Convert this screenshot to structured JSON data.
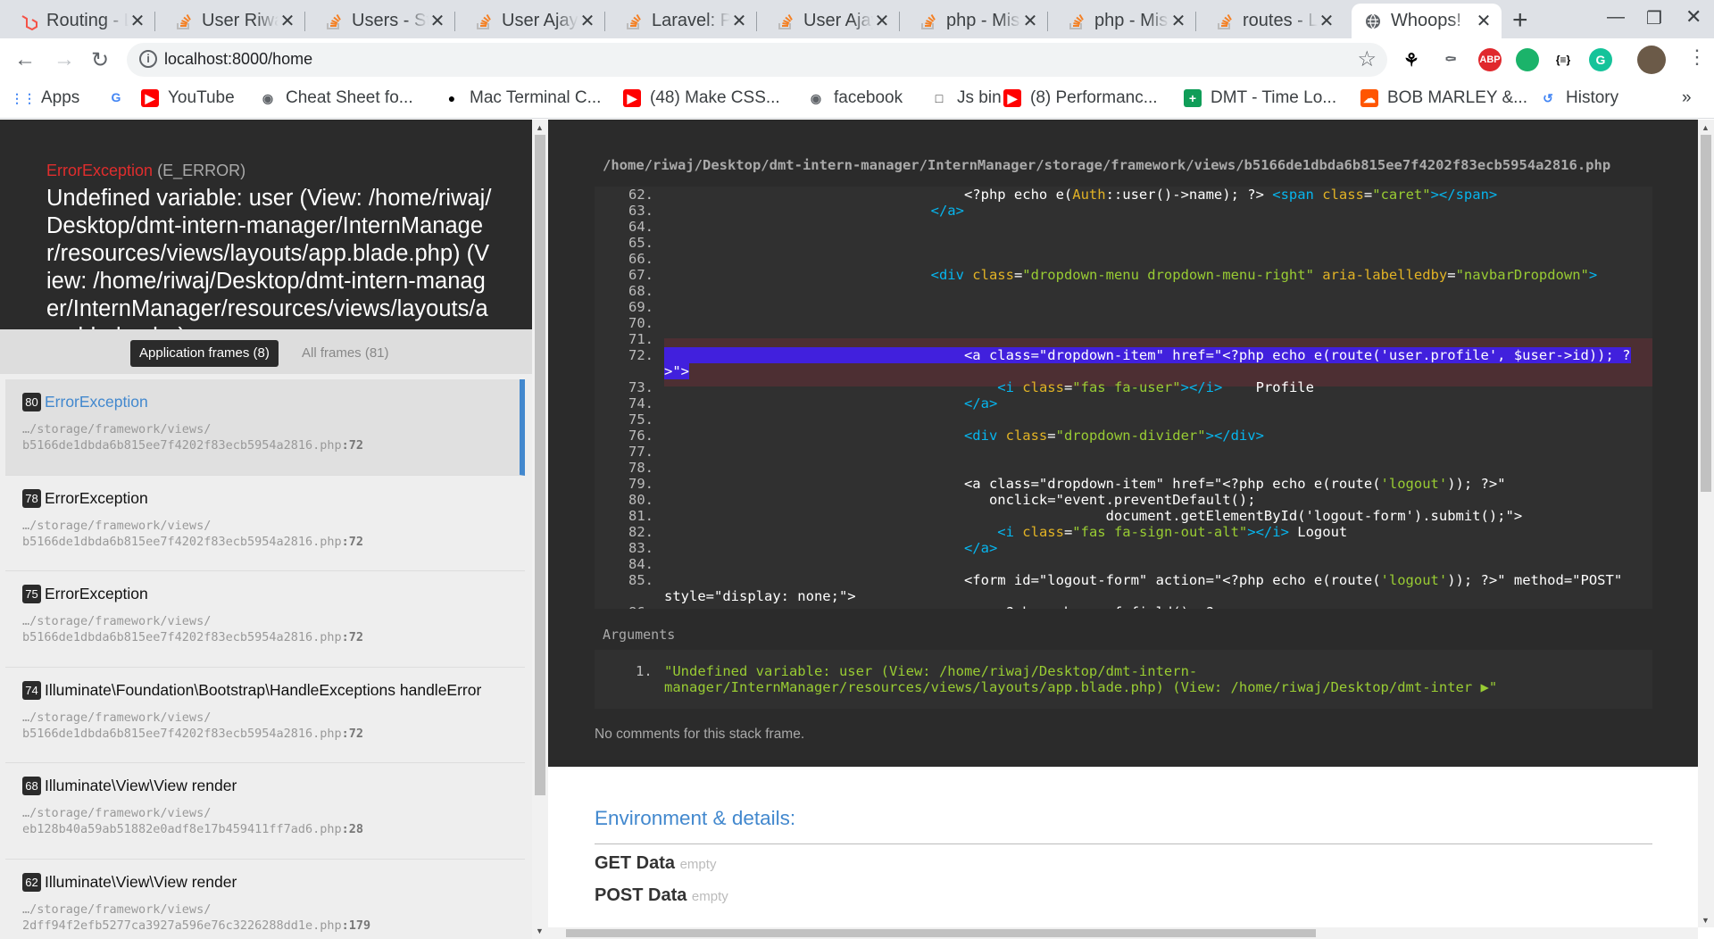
{
  "browser": {
    "tabs": [
      {
        "title": "Routing - Laravel",
        "favicon": "laravel-icon",
        "color": "#f55247"
      },
      {
        "title": "User Riwaj",
        "favicon": "stackoverflow-icon",
        "color": "#f48024"
      },
      {
        "title": "Users - Stack Overflow",
        "favicon": "stackoverflow-icon",
        "color": "#f48024"
      },
      {
        "title": "User Ajay",
        "favicon": "stackoverflow-icon",
        "color": "#f48024"
      },
      {
        "title": "Laravel: Pass",
        "favicon": "stackoverflow-icon",
        "color": "#f48024"
      },
      {
        "title": "User Ajay",
        "favicon": "stackoverflow-icon",
        "color": "#f48024"
      },
      {
        "title": "php - Mis",
        "favicon": "stackoverflow-icon",
        "color": "#f48024"
      },
      {
        "title": "php - Mis",
        "favicon": "stackoverflow-icon",
        "color": "#f48024"
      },
      {
        "title": "routes - L",
        "favicon": "stackoverflow-icon",
        "color": "#f48024"
      },
      {
        "title": "Whoops!",
        "favicon": "globe-icon",
        "color": "#5f6368",
        "active": true
      }
    ],
    "url": "localhost:8000/home",
    "bookmarks": [
      {
        "label": "Apps",
        "icon": "apps-grid-icon"
      },
      {
        "label": "",
        "icon": "google-icon"
      },
      {
        "label": "YouTube",
        "icon": "youtube-icon"
      },
      {
        "label": "Cheat Sheet fo...",
        "icon": "globe-icon"
      },
      {
        "label": "Mac Terminal C...",
        "icon": "github-icon"
      },
      {
        "label": "(48) Make CSS...",
        "icon": "youtube-icon"
      },
      {
        "label": "facebook",
        "icon": "globe-icon"
      },
      {
        "label": "Js bin",
        "icon": "jsbin-icon"
      },
      {
        "label": "(8) Performanc...",
        "icon": "youtube-icon"
      },
      {
        "label": "DMT - Time Lo...",
        "icon": "sheets-icon"
      },
      {
        "label": "BOB MARLEY &...",
        "icon": "soundcloud-icon"
      },
      {
        "label": "History",
        "icon": "history-icon"
      }
    ],
    "more_label": "»"
  },
  "exception": {
    "class": "ErrorException",
    "code": "(E_ERROR)",
    "message": "Undefined variable: user (View: /home/riwaj/Desktop/dmt-intern-manager/InternManager/resources/views/layouts/app.blade.php) (View: /home/riwaj/Desktop/dmt-intern-manager/InternManager/resources/views/layouts/app.blade.php)"
  },
  "frame_tabs": {
    "application": "Application frames (8)",
    "all": "All frames (81)"
  },
  "frames": [
    {
      "num": "80",
      "cls": "ErrorException",
      "path": "…/storage/framework/views/",
      "file": "b5166de1dbda6b815ee7f4202f83ecb5954a2816.php",
      "line": ":72",
      "active": true
    },
    {
      "num": "78",
      "cls": "ErrorException",
      "path": "…/storage/framework/views/",
      "file": "b5166de1dbda6b815ee7f4202f83ecb5954a2816.php",
      "line": ":72"
    },
    {
      "num": "75",
      "cls": "ErrorException",
      "path": "…/storage/framework/views/",
      "file": "b5166de1dbda6b815ee7f4202f83ecb5954a2816.php",
      "line": ":72"
    },
    {
      "num": "74",
      "cls": "Illuminate\\Foundation\\Bootstrap\\HandleExceptions handleError",
      "path": "…/storage/framework/views/",
      "file": "b5166de1dbda6b815ee7f4202f83ecb5954a2816.php",
      "line": ":72"
    },
    {
      "num": "68",
      "cls": "Illuminate\\View\\View render",
      "path": "…/storage/framework/views/",
      "file": "eb128b40a59ab51882e0adf8e17b459411ff7ad6.php",
      "line": ":28"
    },
    {
      "num": "62",
      "cls": "Illuminate\\View\\View render",
      "path": "…/storage/framework/views/",
      "file": "2dff94f2efb5277ca3927a596e76c3226288dd1e.php",
      "line": ":179"
    }
  ],
  "code": {
    "file_path": "/home/riwaj/Desktop/dmt-intern-manager/InternManager/storage/framework/views/b5166de1dbda6b815ee7f4202f83ecb5954a2816.php",
    "lines": [
      {
        "n": "62.",
        "parts": [
          [
            "p",
            "                                    <?php echo e("
          ],
          [
            "a",
            "Auth"
          ],
          [
            "p",
            "::user()->name); ?> "
          ],
          [
            "t",
            "<span "
          ],
          [
            "a",
            "class"
          ],
          [
            "p",
            "="
          ],
          [
            "s",
            "\"caret\""
          ],
          [
            "t",
            "></span>"
          ]
        ]
      },
      {
        "n": "63.",
        "parts": [
          [
            "t",
            "                                </a>"
          ]
        ]
      },
      {
        "n": "64.",
        "parts": []
      },
      {
        "n": "65.",
        "parts": []
      },
      {
        "n": "66.",
        "parts": []
      },
      {
        "n": "67.",
        "parts": [
          [
            "t",
            "                                <div "
          ],
          [
            "a",
            "class"
          ],
          [
            "p",
            "="
          ],
          [
            "s",
            "\"dropdown-menu dropdown-menu-right\""
          ],
          [
            "a",
            " aria-labelledby"
          ],
          [
            "p",
            "="
          ],
          [
            "s",
            "\"navbarDropdown\""
          ],
          [
            "t",
            ">"
          ]
        ]
      },
      {
        "n": "68.",
        "parts": []
      },
      {
        "n": "69.",
        "parts": []
      },
      {
        "n": "70.",
        "parts": []
      },
      {
        "n": "71.",
        "parts": []
      },
      {
        "n": "72.",
        "parts": [
          [
            "h",
            "                                    <a class=\"dropdown-item\" href=\"<?php echo e(route('user.profile', $user->id)); ?"
          ]
        ]
      },
      {
        "n": "",
        "parts": [
          [
            "h",
            ">\">"
          ]
        ]
      },
      {
        "n": "73.",
        "parts": [
          [
            "t",
            "                                        <i "
          ],
          [
            "a",
            "class"
          ],
          [
            "p",
            "="
          ],
          [
            "s",
            "\"fas fa-user\""
          ],
          [
            "t",
            "></i>"
          ],
          [
            "p",
            "    Profile"
          ]
        ]
      },
      {
        "n": "74.",
        "parts": [
          [
            "t",
            "                                    </a>"
          ]
        ]
      },
      {
        "n": "75.",
        "parts": []
      },
      {
        "n": "76.",
        "parts": [
          [
            "t",
            "                                    <div "
          ],
          [
            "a",
            "class"
          ],
          [
            "p",
            "="
          ],
          [
            "s",
            "\"dropdown-divider\""
          ],
          [
            "t",
            "></div>"
          ]
        ]
      },
      {
        "n": "77.",
        "parts": []
      },
      {
        "n": "78.",
        "parts": []
      },
      {
        "n": "79.",
        "parts": [
          [
            "p",
            "                                    <a class=\"dropdown-item\" href=\"<?php echo e(route("
          ],
          [
            "s",
            "'logout'"
          ],
          [
            "p",
            ")); ?>\""
          ]
        ]
      },
      {
        "n": "80.",
        "parts": [
          [
            "p",
            "                                       onclick=\"event.preventDefault();"
          ]
        ]
      },
      {
        "n": "81.",
        "parts": [
          [
            "p",
            "                                                     document.getElementById('logout-form').submit();\">"
          ]
        ]
      },
      {
        "n": "82.",
        "parts": [
          [
            "t",
            "                                        <i "
          ],
          [
            "a",
            "class"
          ],
          [
            "p",
            "="
          ],
          [
            "s",
            "\"fas fa-sign-out-alt\""
          ],
          [
            "t",
            "></i>"
          ],
          [
            "p",
            " Logout"
          ]
        ]
      },
      {
        "n": "83.",
        "parts": [
          [
            "t",
            "                                    </a>"
          ]
        ]
      },
      {
        "n": "84.",
        "parts": []
      },
      {
        "n": "85.",
        "parts": [
          [
            "p",
            "                                    <form id=\"logout-form\" action=\"<?php echo e(route("
          ],
          [
            "s",
            "'logout'"
          ],
          [
            "p",
            ")); ?>\" method=\"POST\""
          ]
        ]
      },
      {
        "n": "",
        "parts": [
          [
            "p",
            "style=\"display: none;\">"
          ]
        ]
      },
      {
        "n": "86.",
        "parts": [
          [
            "p",
            "                                        <?php echo csrf_field(); ?>"
          ]
        ]
      }
    ]
  },
  "arguments": {
    "label": "Arguments",
    "items": [
      {
        "n": "1.",
        "value": "\"Undefined variable: user (View: /home/riwaj/Desktop/dmt-intern-manager/InternManager/resources/views/layouts/app.blade.php) (View: /home/riwaj/Desktop/dmt-inter ▶\""
      }
    ]
  },
  "comments": "No comments for this stack frame.",
  "environment": {
    "title": "Environment & details:",
    "rows": [
      {
        "label": "GET Data",
        "value": "empty"
      },
      {
        "label": "POST Data",
        "value": "empty"
      }
    ]
  }
}
